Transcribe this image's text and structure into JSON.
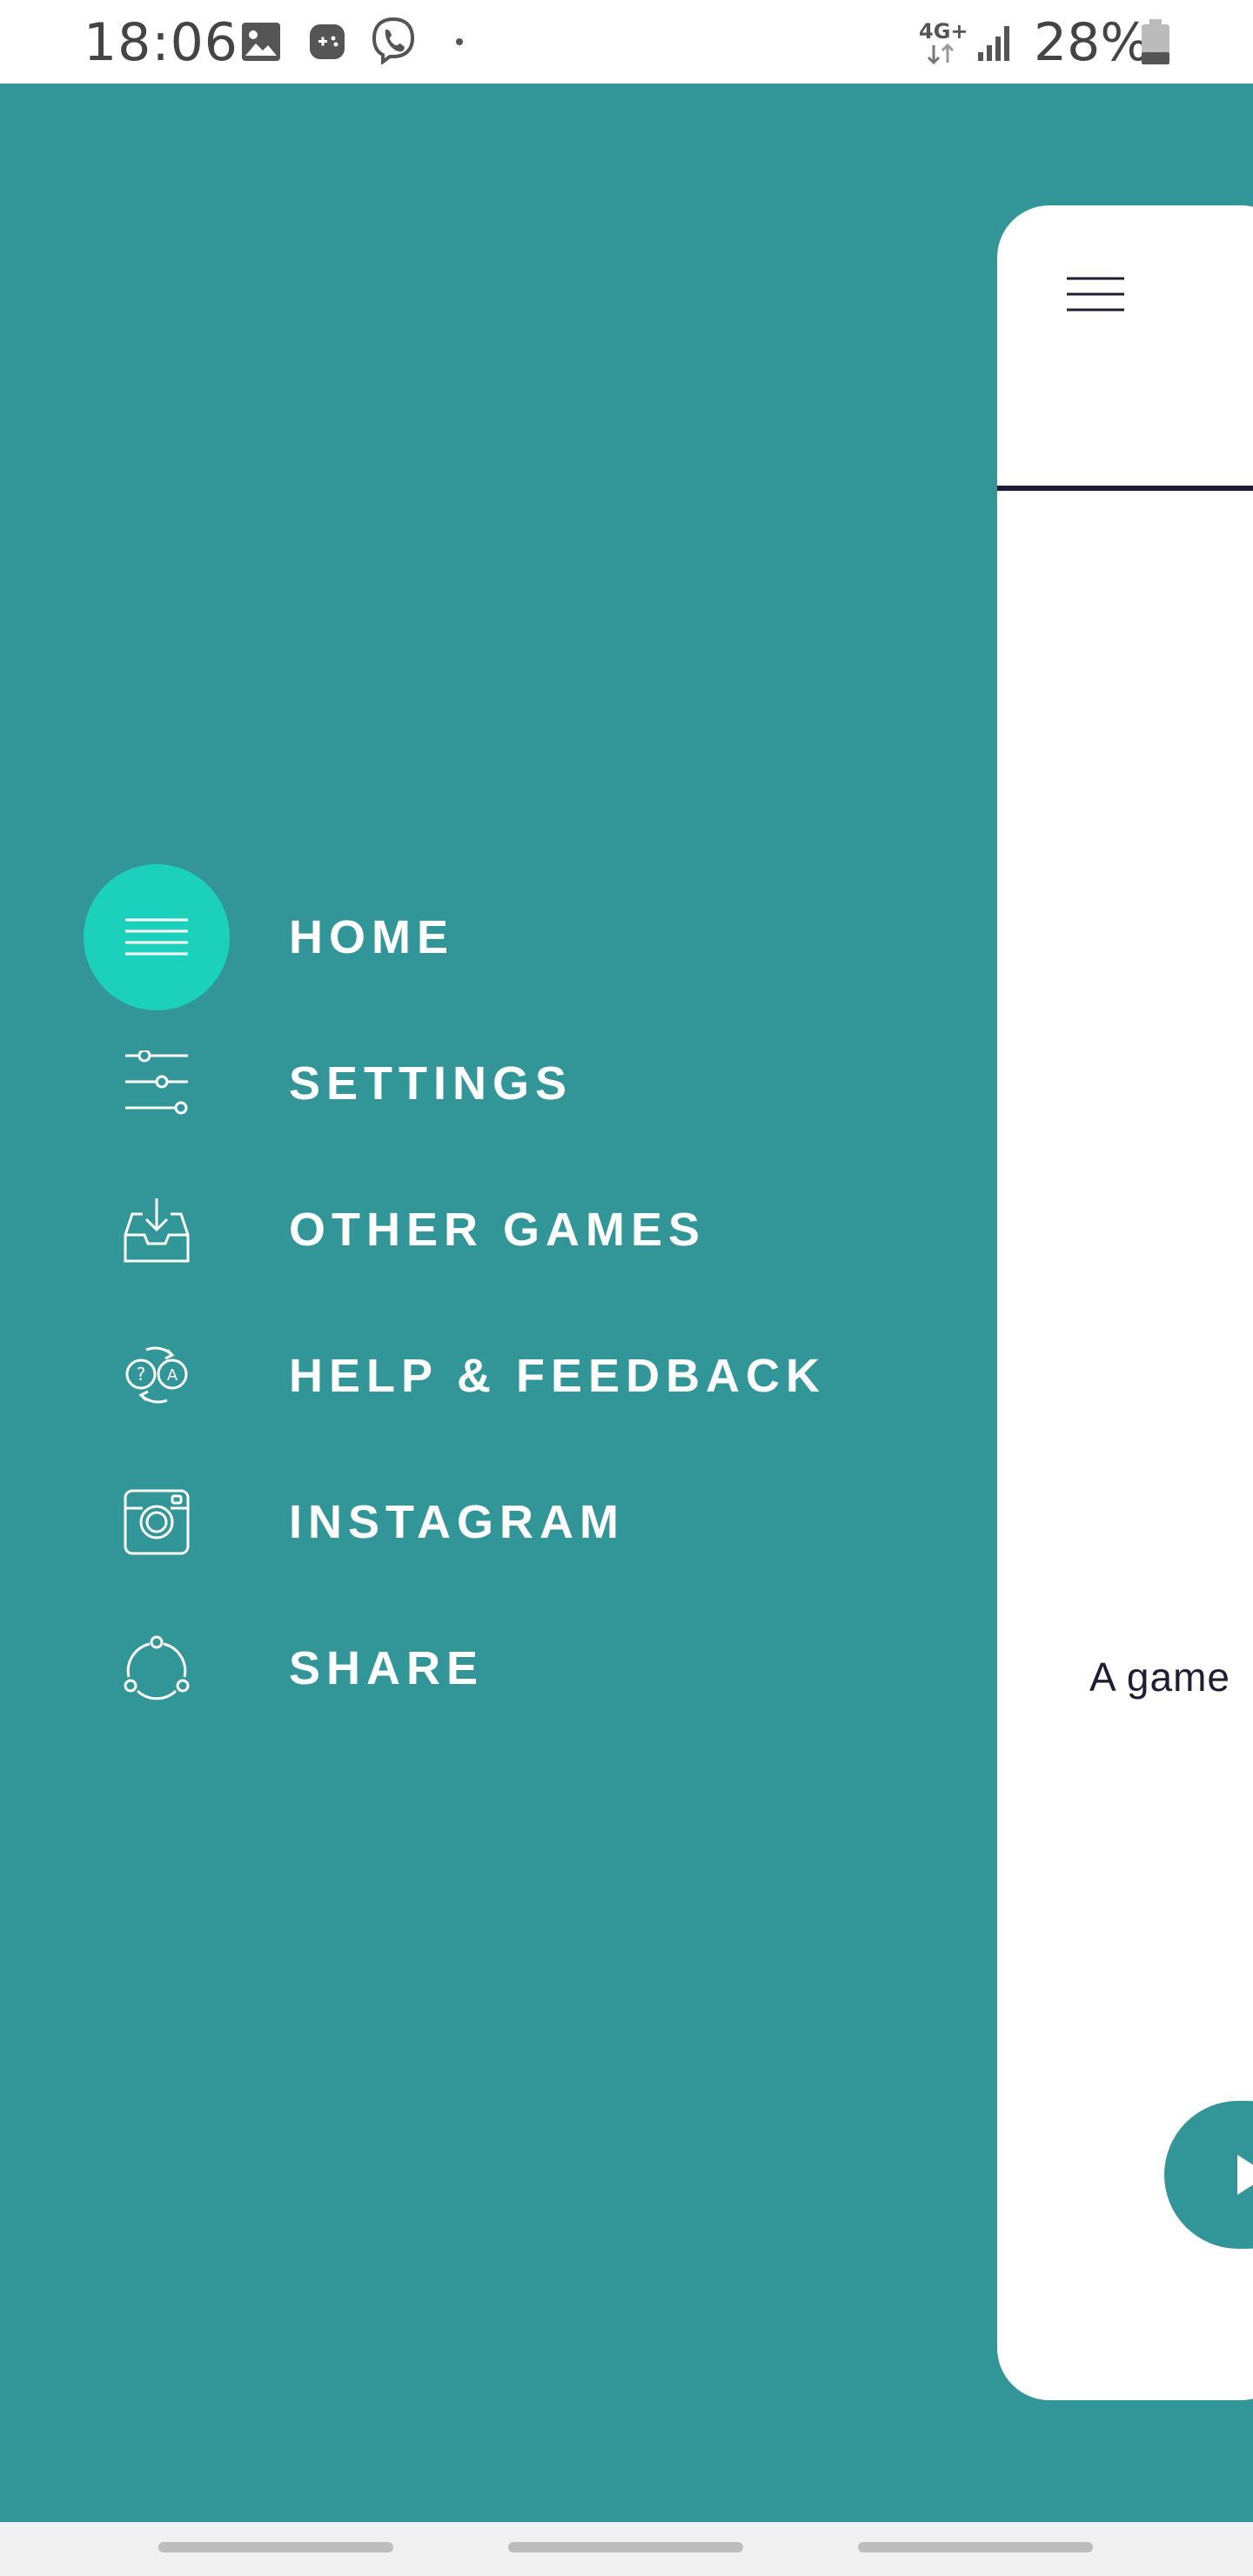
{
  "status_bar": {
    "time": "18:06",
    "network": "4G+",
    "battery_percent": "28%",
    "icons": [
      "gallery-icon",
      "game-icon",
      "viber-icon",
      "dot-icon",
      "network-type-icon",
      "signal-icon",
      "battery-icon"
    ]
  },
  "drawer": {
    "accent_color": "#1bd1bb",
    "background_color": "#329699",
    "items": [
      {
        "label": "HOME",
        "icon": "menu-lines-icon",
        "active": true
      },
      {
        "label": "SETTINGS",
        "icon": "sliders-icon",
        "active": false
      },
      {
        "label": "OTHER GAMES",
        "icon": "inbox-download-icon",
        "active": false
      },
      {
        "label": "HELP & FEEDBACK",
        "icon": "help-translate-icon",
        "active": false
      },
      {
        "label": "INSTAGRAM",
        "icon": "instagram-icon",
        "active": false
      },
      {
        "label": "SHARE",
        "icon": "share-icon",
        "active": false
      }
    ]
  },
  "main_card": {
    "subtitle": "A game"
  }
}
